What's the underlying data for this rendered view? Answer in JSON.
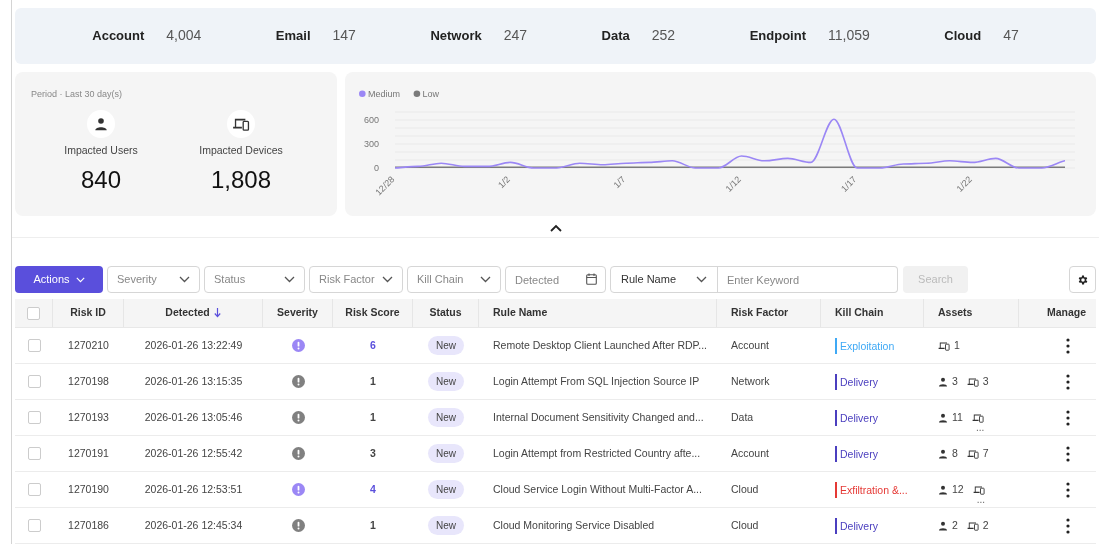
{
  "summary": [
    {
      "label": "Account",
      "count": "4,004"
    },
    {
      "label": "Email",
      "count": "147"
    },
    {
      "label": "Network",
      "count": "247"
    },
    {
      "label": "Data",
      "count": "252"
    },
    {
      "label": "Endpoint",
      "count": "11,059"
    },
    {
      "label": "Cloud",
      "count": "47"
    }
  ],
  "impact": {
    "period": "Period · Last 30 day(s)",
    "stats": [
      {
        "kind": "users",
        "label": "Impacted Users",
        "value": "840"
      },
      {
        "kind": "devices",
        "label": "Impacted Devices",
        "value": "1,808"
      }
    ]
  },
  "trend": {
    "chart_data": {
      "type": "line",
      "categories": [
        "12/28",
        null,
        null,
        null,
        null,
        "1/2",
        null,
        null,
        null,
        null,
        "1/7",
        null,
        null,
        null,
        null,
        "1/12",
        null,
        null,
        null,
        null,
        "1/17",
        null,
        null,
        null,
        null,
        "1/22",
        null,
        null,
        null,
        null
      ],
      "legend": "top-left",
      "ylim": [
        0,
        700
      ],
      "yticks": [
        0,
        300,
        600
      ],
      "series": [
        {
          "name": "Medium",
          "color": "#9b87f5",
          "values": [
            0,
            20,
            60,
            20,
            20,
            70,
            0,
            0,
            60,
            40,
            60,
            70,
            90,
            0,
            0,
            150,
            90,
            120,
            70,
            610,
            0,
            0,
            50,
            60,
            90,
            70,
            120,
            0,
            0,
            90
          ]
        },
        {
          "name": "Low",
          "color": "#7a7a7a",
          "values": [
            10,
            10,
            10,
            10,
            10,
            10,
            10,
            10,
            10,
            10,
            10,
            10,
            10,
            10,
            10,
            10,
            10,
            10,
            10,
            10,
            10,
            10,
            10,
            10,
            10,
            10,
            10,
            10,
            10,
            10
          ]
        }
      ]
    }
  },
  "filters": {
    "actions": "Actions",
    "selects": [
      "Severity",
      "Status",
      "Risk Factor",
      "Kill Chain"
    ],
    "date_placeholder": "Detected",
    "rule_select": "Rule Name",
    "keyword_placeholder": "Enter Keyword",
    "search": "Search",
    "search_disabled": true
  },
  "table": {
    "columns": [
      {
        "label": "Risk ID",
        "sorted": false
      },
      {
        "label": "Detected",
        "sorted": true
      },
      {
        "label": "Severity",
        "sorted": false
      },
      {
        "label": "Risk Score",
        "sorted": false
      },
      {
        "label": "Status",
        "sorted": false
      },
      {
        "label": "Rule Name",
        "sorted": false
      },
      {
        "label": "Risk Factor",
        "sorted": false
      },
      {
        "label": "Kill Chain",
        "sorted": false
      },
      {
        "label": "Assets",
        "sorted": false
      },
      {
        "label": "Manage",
        "sorted": false
      }
    ],
    "all_checked": false,
    "rows": [
      {
        "checked": false,
        "id": "1270210",
        "detected": "2026-01-26 13:22:49",
        "severity": {
          "color": "#9b87f5"
        },
        "score": {
          "text": "6",
          "highlighted": true
        },
        "status": "New",
        "rule": "Remote Desktop Client Launched After RDP...",
        "factor": "Account",
        "kill_chain": {
          "label": "Exploitation",
          "color": "#3fa9f5"
        },
        "assets": {
          "devices": "1"
        }
      },
      {
        "checked": false,
        "id": "1270198",
        "detected": "2026-01-26 13:15:35",
        "severity": {
          "color": "#808080"
        },
        "score": {
          "text": "1",
          "highlighted": false
        },
        "status": "New",
        "rule": "Login Attempt From SQL Injection Source IP",
        "factor": "Network",
        "kill_chain": {
          "label": "Delivery",
          "color": "#4b3fbf"
        },
        "assets": {
          "users": "3",
          "devices": "3"
        }
      },
      {
        "checked": false,
        "id": "1270193",
        "detected": "2026-01-26 13:05:46",
        "severity": {
          "color": "#808080"
        },
        "score": {
          "text": "1",
          "highlighted": false
        },
        "status": "New",
        "rule": "Internal Document Sensitivity Changed and...",
        "factor": "Data",
        "kill_chain": {
          "label": "Delivery",
          "color": "#4b3fbf"
        },
        "assets": {
          "users": "11",
          "devices": "..."
        }
      },
      {
        "checked": false,
        "id": "1270191",
        "detected": "2026-01-26 12:55:42",
        "severity": {
          "color": "#808080"
        },
        "score": {
          "text": "3",
          "highlighted": false
        },
        "status": "New",
        "rule": "Login Attempt from Restricted Country afte...",
        "factor": "Account",
        "kill_chain": {
          "label": "Delivery",
          "color": "#4b3fbf"
        },
        "assets": {
          "users": "8",
          "devices": "7"
        }
      },
      {
        "checked": false,
        "id": "1270190",
        "detected": "2026-01-26 12:53:51",
        "severity": {
          "color": "#9b87f5"
        },
        "score": {
          "text": "4",
          "highlighted": true
        },
        "status": "New",
        "rule": "Cloud Service Login Without Multi-Factor A...",
        "factor": "Cloud",
        "kill_chain": {
          "label": "Exfiltration &...",
          "color": "#e53935"
        },
        "assets": {
          "users": "12",
          "devices": "..."
        }
      },
      {
        "checked": false,
        "id": "1270186",
        "detected": "2026-01-26 12:45:34",
        "severity": {
          "color": "#808080"
        },
        "score": {
          "text": "1",
          "highlighted": false
        },
        "status": "New",
        "rule": "Cloud Monitoring Service Disabled",
        "factor": "Cloud",
        "kill_chain": {
          "label": "Delivery",
          "color": "#4b3fbf"
        },
        "assets": {
          "users": "2",
          "devices": "2"
        }
      }
    ]
  }
}
